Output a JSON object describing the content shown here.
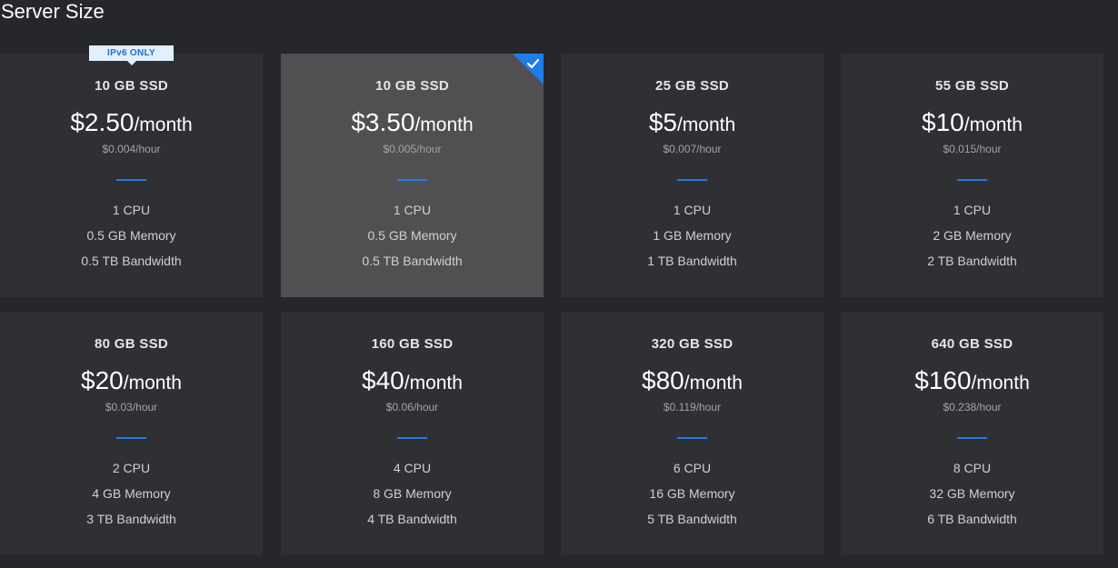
{
  "page": {
    "title": "Server Size"
  },
  "accent_color": "#1f7ce8",
  "selected_index": 1,
  "plans": [
    {
      "disk": "10 GB SSD",
      "price": "$2.50",
      "per": "/month",
      "hourly": "$0.004/hour",
      "cpu": "1 CPU",
      "memory": "0.5 GB Memory",
      "bandwidth": "0.5 TB Bandwidth",
      "badge": "IPv6 ONLY"
    },
    {
      "disk": "10 GB SSD",
      "price": "$3.50",
      "per": "/month",
      "hourly": "$0.005/hour",
      "cpu": "1 CPU",
      "memory": "0.5 GB Memory",
      "bandwidth": "0.5 TB Bandwidth"
    },
    {
      "disk": "25 GB SSD",
      "price": "$5",
      "per": "/month",
      "hourly": "$0.007/hour",
      "cpu": "1 CPU",
      "memory": "1 GB Memory",
      "bandwidth": "1 TB Bandwidth"
    },
    {
      "disk": "55 GB SSD",
      "price": "$10",
      "per": "/month",
      "hourly": "$0.015/hour",
      "cpu": "1 CPU",
      "memory": "2 GB Memory",
      "bandwidth": "2 TB Bandwidth"
    },
    {
      "disk": "80 GB SSD",
      "price": "$20",
      "per": "/month",
      "hourly": "$0.03/hour",
      "cpu": "2 CPU",
      "memory": "4 GB Memory",
      "bandwidth": "3 TB Bandwidth"
    },
    {
      "disk": "160 GB SSD",
      "price": "$40",
      "per": "/month",
      "hourly": "$0.06/hour",
      "cpu": "4 CPU",
      "memory": "8 GB Memory",
      "bandwidth": "4 TB Bandwidth"
    },
    {
      "disk": "320 GB SSD",
      "price": "$80",
      "per": "/month",
      "hourly": "$0.119/hour",
      "cpu": "6 CPU",
      "memory": "16 GB Memory",
      "bandwidth": "5 TB Bandwidth"
    },
    {
      "disk": "640 GB SSD",
      "price": "$160",
      "per": "/month",
      "hourly": "$0.238/hour",
      "cpu": "8 CPU",
      "memory": "32 GB Memory",
      "bandwidth": "6 TB Bandwidth"
    }
  ]
}
